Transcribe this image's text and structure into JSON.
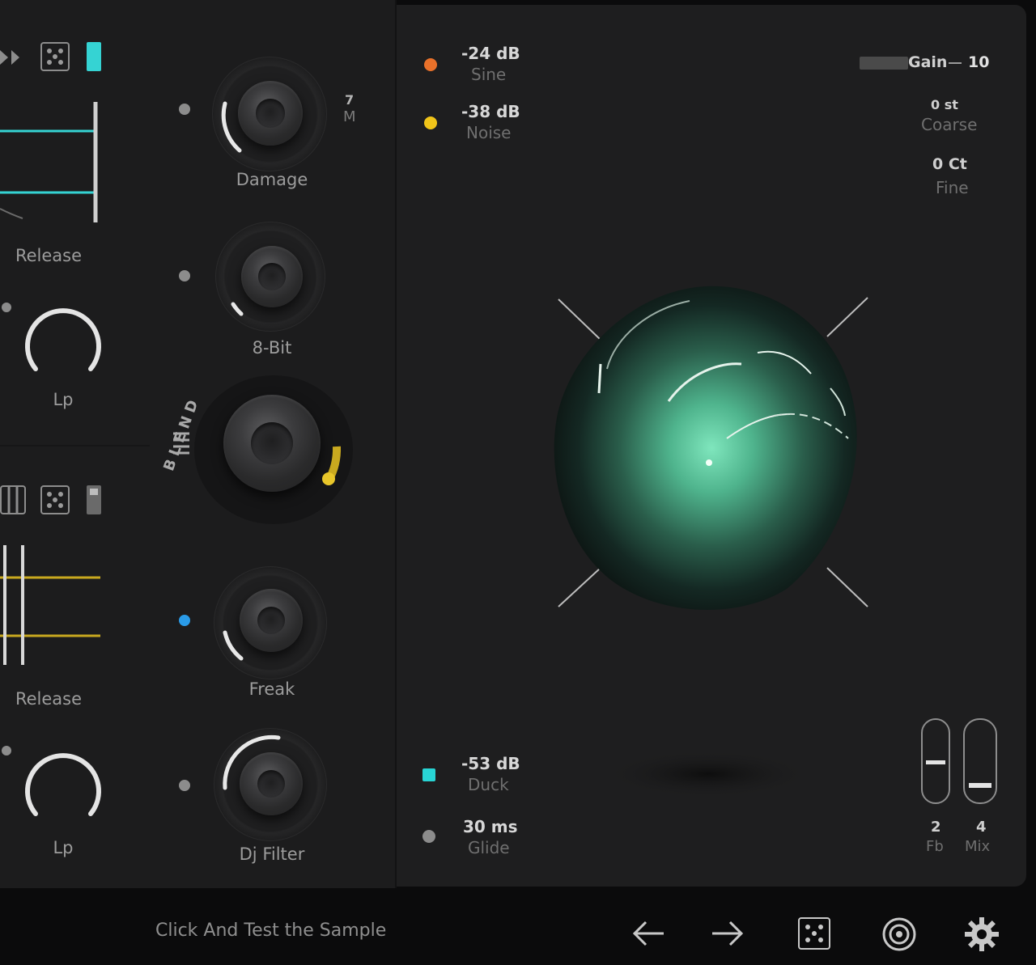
{
  "left": {
    "release_label_top": "Release",
    "lp_label_top": "Lp",
    "release_label_bottom": "Release",
    "lp_label_bottom": "Lp"
  },
  "knobs": {
    "damage": "Damage",
    "damage_side_value": "7",
    "damage_side_unit": "M",
    "bit": "8-Bit",
    "blend": "BLEND",
    "freak": "Freak",
    "dj_filter": "Dj Filter"
  },
  "meters": {
    "sine": {
      "value": "-24 dB",
      "name": "Sine",
      "color": "#e9712a"
    },
    "noise": {
      "value": "-38 dB",
      "name": "Noise",
      "color": "#f0c419"
    },
    "duck": {
      "value": "-53 dB",
      "name": "Duck",
      "color": "#28d4d4"
    },
    "glide": {
      "value": "30 ms",
      "name": "Glide",
      "color": "#8c8c8c"
    }
  },
  "right_top": {
    "gain_label": "Gain",
    "gain_value": "10",
    "coarse_value": "0 st",
    "coarse_name": "Coarse",
    "fine_value": "0 Ct",
    "fine_name": "Fine"
  },
  "sliders": {
    "fb_value": "2",
    "fb_name": "Fb",
    "mix_value": "4",
    "mix_name": "Mix"
  },
  "footer": {
    "hint": "Click And Test the Sample"
  },
  "colors": {
    "accent_cyan": "#35d3d3",
    "accent_yellow": "#c9a91f",
    "orb_green": "#5fd4a6"
  },
  "icons": [
    "play-icon",
    "dice-icon",
    "piano-icon",
    "arrow-left-icon",
    "arrow-right-icon",
    "target-icon",
    "gear-icon"
  ]
}
